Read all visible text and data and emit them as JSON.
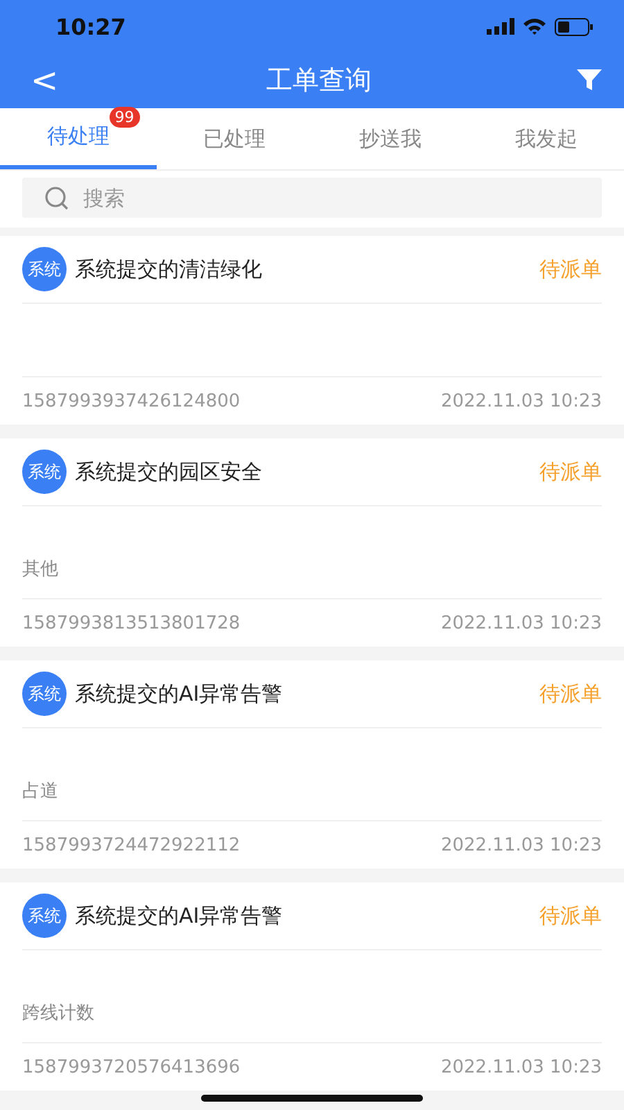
{
  "status_bar": {
    "time": "10:27"
  },
  "nav": {
    "back": "<",
    "title": "工单查询"
  },
  "tabs": [
    {
      "label": "待处理",
      "selected": true,
      "badge": "99"
    },
    {
      "label": "已处理",
      "selected": false
    },
    {
      "label": "抄送我",
      "selected": false
    },
    {
      "label": "我发起",
      "selected": false
    }
  ],
  "search": {
    "placeholder": "搜索"
  },
  "orders": [
    {
      "avatar": "系统",
      "title": "系统提交的清洁绿化",
      "status": "待派单",
      "number": "1587993937426124800",
      "time": "2022.11.03 10:23"
    },
    {
      "avatar": "系统",
      "title": "系统提交的园区安全",
      "status": "待派单",
      "note": "其他",
      "number": "1587993813513801728",
      "time": "2022.11.03 10:23"
    },
    {
      "avatar": "系统",
      "title": "系统提交的AI异常告警",
      "status": "待派单",
      "note": "占道",
      "number": "1587993724472922112",
      "time": "2022.11.03 10:23"
    },
    {
      "avatar": "系统",
      "title": "系统提交的AI异常告警",
      "status": "待派单",
      "note": "跨线计数",
      "number": "1587993720576413696",
      "time": "2022.11.03 10:23"
    }
  ]
}
